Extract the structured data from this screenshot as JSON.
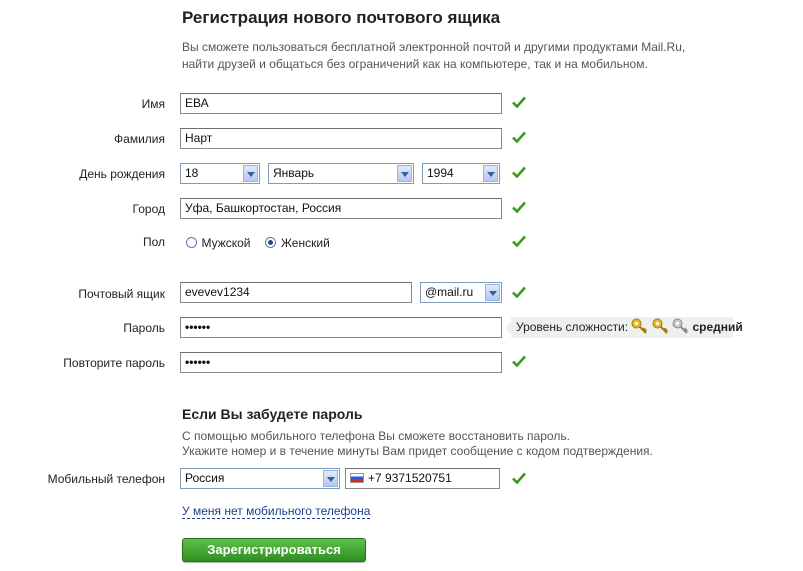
{
  "page": {
    "title": "Регистрация нового почтового ящика",
    "intro_line1": "Вы сможете пользоваться бесплатной электронной почтой и другими продуктами Mail.Ru,",
    "intro_line2": "найти друзей и общаться без ограничений как на компьютере, так и на мобильном."
  },
  "form": {
    "name_label": "Имя",
    "name_value": "ЕВА",
    "surname_label": "Фамилия",
    "surname_value": "Нарт",
    "birthday_label": "День рождения",
    "birthday_day": "18",
    "birthday_month": "Январь",
    "birthday_year": "1994",
    "city_label": "Город",
    "city_value": "Уфа, Башкортостан, Россия",
    "gender_label": "Пол",
    "gender_male": "Мужской",
    "gender_female": "Женский",
    "gender_selected": "female",
    "mailbox_label": "Почтовый ящик",
    "mailbox_value": "evevev1234",
    "domain_value": "@mail.ru",
    "password_label": "Пароль",
    "password_value": "••••••",
    "password_repeat_label": "Повторите пароль",
    "password_repeat_value": "••••••",
    "strength_label": "Уровень сложности:",
    "strength_value": "средний",
    "strength_keys_active": 2,
    "strength_keys_total": 3
  },
  "recovery": {
    "title": "Если Вы забудете пароль",
    "text_line1": "С помощью мобильного телефона Вы сможете восстановить пароль.",
    "text_line2": "Укажите номер и в течение минуты Вам придет сообщение с кодом подтверждения.",
    "phone_label": "Мобильный телефон",
    "country_value": "Россия",
    "phone_value": "+7 9371520751",
    "no_phone_link": "У меня нет мобильного телефона"
  },
  "submit_label": "Зарегистрироваться",
  "colors": {
    "check": "#3a9a1e",
    "button": "#3fa52f",
    "link": "#1a3f8c"
  }
}
